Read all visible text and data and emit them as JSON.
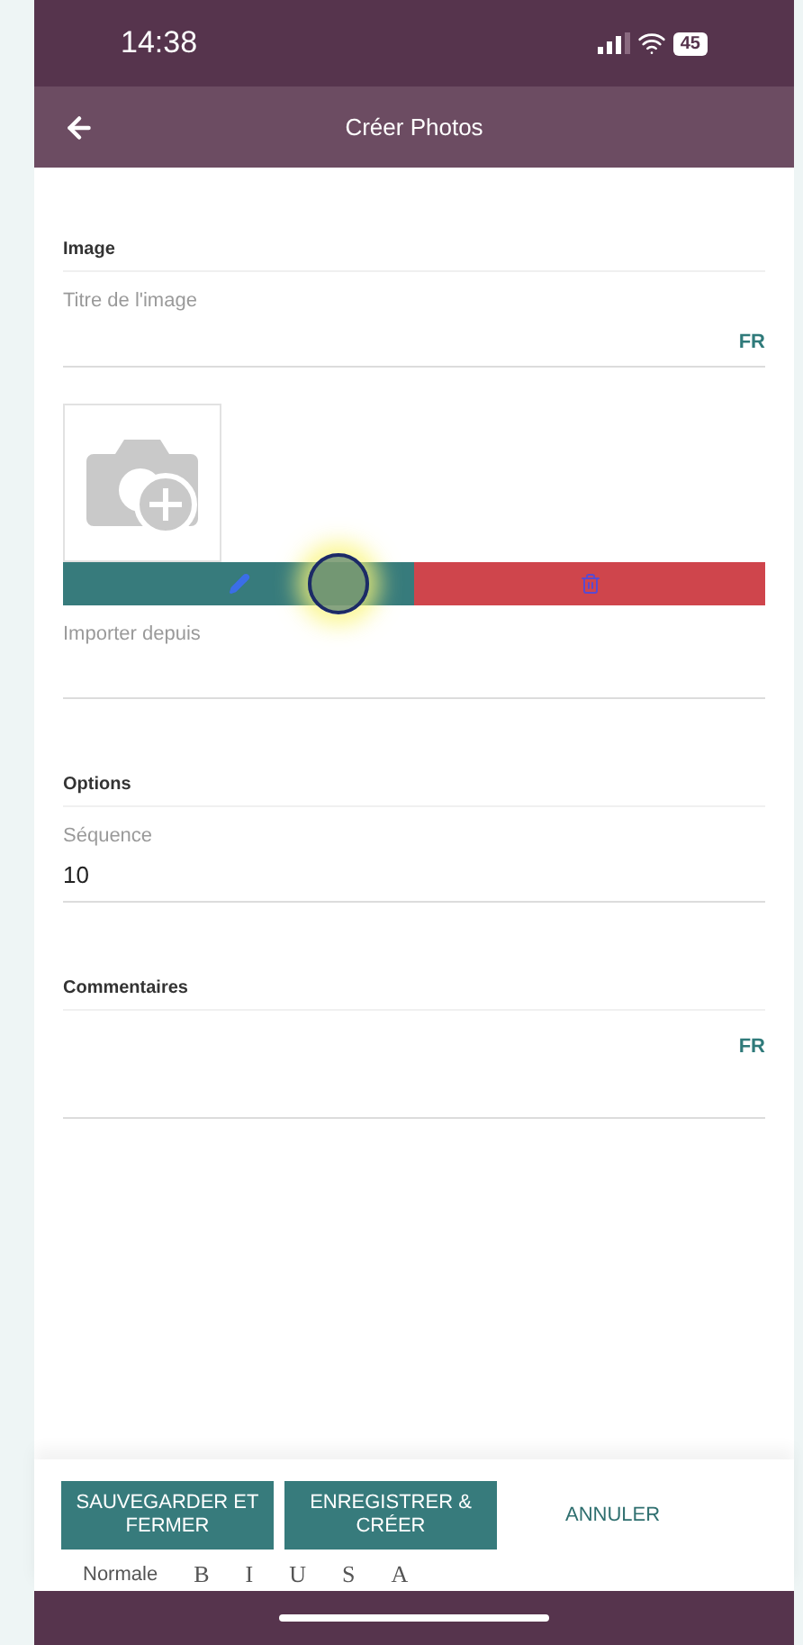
{
  "status_bar": {
    "time": "14:38",
    "battery": "45"
  },
  "header": {
    "title": "Créer Photos"
  },
  "sections": [
    {
      "title": "Image",
      "fields": [
        {
          "kind": "text",
          "label": "Titre de l'image",
          "lang": "FR"
        },
        {
          "kind": "image"
        },
        {
          "kind": "text",
          "label": "Importer depuis"
        }
      ]
    },
    {
      "title": "Options",
      "fields": [
        {
          "kind": "text",
          "label": "Séquence",
          "value": "10"
        }
      ]
    },
    {
      "title": "Commentaires",
      "fields": [
        {
          "kind": "note",
          "lang": "FR"
        }
      ]
    }
  ],
  "footer": {
    "buttons": [
      {
        "label": "SAUVEGARDER ET FERMER",
        "kind": "primary"
      },
      {
        "label": "ENREGISTRER & CRÉER",
        "kind": "primary"
      },
      {
        "label": "ANNULER",
        "kind": "link"
      }
    ],
    "toolbar": [
      "Normale",
      "B",
      "I",
      "U",
      "S",
      "A"
    ]
  }
}
